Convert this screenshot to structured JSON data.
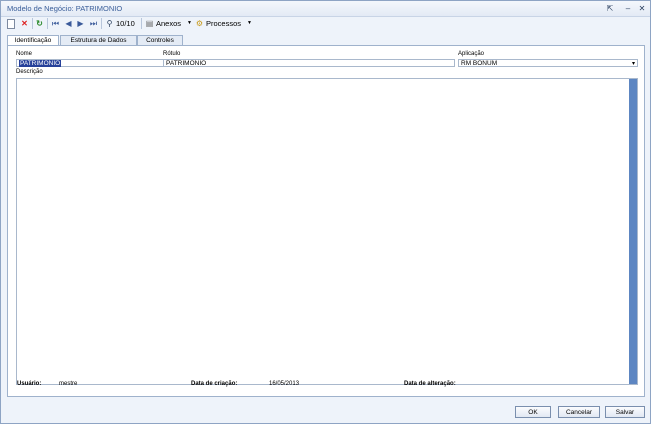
{
  "window": {
    "title": "Modelo de Negócio: PATRIMONIO"
  },
  "toolbar": {
    "record_counter": "10/10",
    "anexos_label": "Anexos",
    "processos_label": "Processos"
  },
  "tabs": [
    {
      "label": "Identificação",
      "active": true
    },
    {
      "label": "Estrutura de Dados",
      "active": false
    },
    {
      "label": "Controles",
      "active": false
    }
  ],
  "form": {
    "nome_label": "Nome",
    "nome_value": "PATRIMONIO",
    "rotulo_label": "Rótulo",
    "rotulo_value": "PATRIMONIO",
    "aplicacao_label": "Aplicação",
    "aplicacao_value": "RM BONUM",
    "descricao_label": "Descrição",
    "descricao_value": ""
  },
  "footer": {
    "usuario_label": "Usuário:",
    "usuario_value": "mestre",
    "data_criacao_label": "Data de criação:",
    "data_criacao_value": "16/05/2013",
    "data_alteracao_label": "Data de alteração:",
    "data_alteracao_value": ""
  },
  "buttons": {
    "ok": "OK",
    "cancelar": "Cancelar",
    "salvar": "Salvar"
  },
  "colors": {
    "accent": "#3b5f9a",
    "scrollbar": "#5d86c2",
    "selection": "#27419a"
  }
}
